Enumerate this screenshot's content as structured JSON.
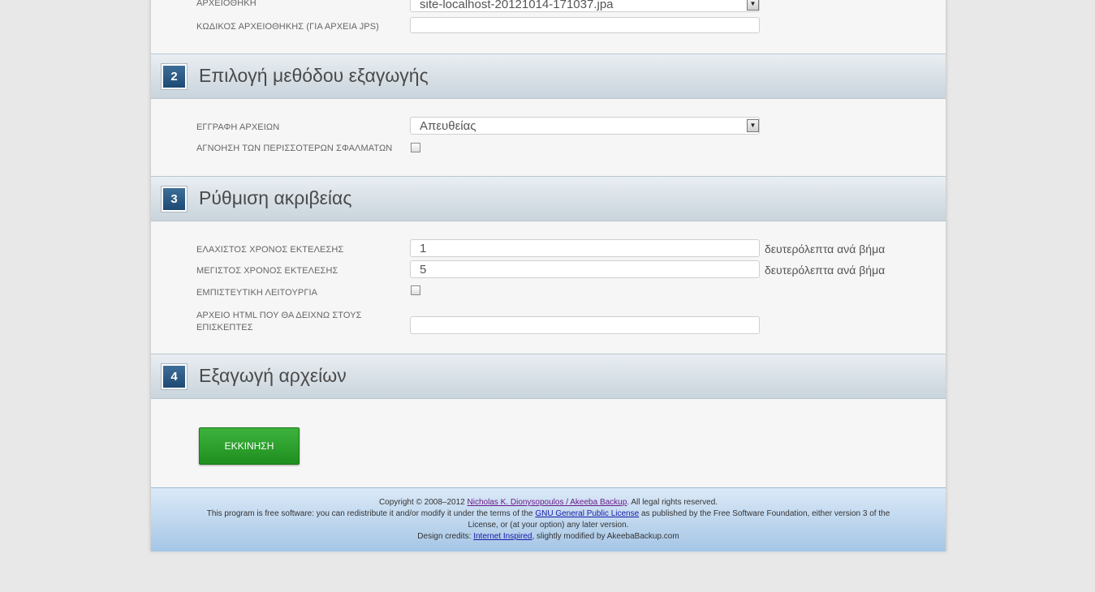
{
  "section1": {
    "archive_label": "ΑΡΧΕΙΟΘΗΚΗ",
    "archive_value": "site-localhost-20121014-171037.jpa",
    "archive_password_label": "ΚΩΔΙΚΟΣ ΑΡΧΕΙΟΘΗΚΗΣ (ΓΙΑ ΑΡΧΕΙΑ JPS)",
    "archive_password_value": ""
  },
  "section2": {
    "number": "2",
    "title": "Επιλογή μεθόδου εξαγωγής",
    "write_files_label": "ΕΓΓΡΑΦΗ ΑΡΧΕΙΩΝ",
    "write_files_value": "Απευθείας",
    "ignore_errors_label": "ΑΓΝΟΗΣΗ ΤΩΝ ΠΕΡΙΣΣΟΤΕΡΩΝ ΣΦΑΛΜΑΤΩΝ"
  },
  "section3": {
    "number": "3",
    "title": "Ρύθμιση ακριβείας",
    "min_time_label": "ΕΛΑΧΙΣΤΟΣ ΧΡΟΝΟΣ ΕΚΤΕΛΕΣΗΣ",
    "min_time_value": "1",
    "max_time_label": "ΜΕΓΙΣΤΟΣ ΧΡΟΝΟΣ ΕΚΤΕΛΕΣΗΣ",
    "max_time_value": "5",
    "unit_suffix": "δευτερόλεπτα ανά βήμα",
    "stealth_label": "ΕΜΠΙΣΤΕΥΤΙΚΗ ΛΕΙΤΟΥΡΓΙΑ",
    "html_file_label_line1": "ΑΡΧΕΙΟ HTML ΠΟΥ ΘΑ ΔΕΙΧΝΩ ΣΤΟΥΣ",
    "html_file_label_line2": "ΕΠΙΣΚΕΠΤΕΣ",
    "html_file_value": ""
  },
  "section4": {
    "number": "4",
    "title": "Εξαγωγή αρχείων",
    "start_label": "ΕΚΚΙΝΗΣΗ"
  },
  "footer": {
    "copyright_prefix": "Copyright © 2008–2012 ",
    "author_link": "Nicholas K. Dionysopoulos / Akeeba Backup",
    "copyright_suffix": ". All legal rights reserved.",
    "license_prefix": "This program is free software: you can redistribute it and/or modify it under the terms of the ",
    "license_link": "GNU General Public License",
    "license_suffix_line1": " as published by the Free Software Foundation, either version 3 of the",
    "license_suffix_line2": "License, or (at your option) any later version.",
    "design_prefix": "Design credits: ",
    "design_link": "Internet Inspired",
    "design_suffix": ", slightly modified by AkeebaBackup.com"
  }
}
